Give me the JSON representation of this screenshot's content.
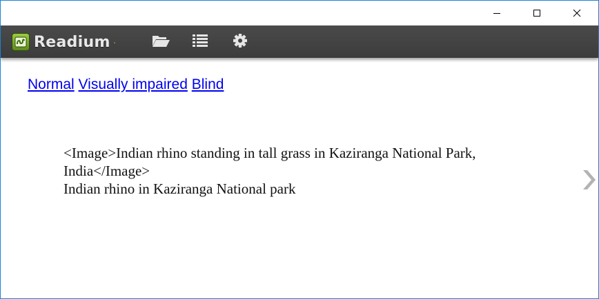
{
  "window": {
    "controls": {
      "minimize_icon": "minimize-icon",
      "maximize_icon": "maximize-icon",
      "close_icon": "close-icon"
    }
  },
  "toolbar": {
    "app_name": "Readium",
    "app_name_dot": "·",
    "accent_color": "#8cc63f",
    "background_color": "#444444",
    "buttons": [
      {
        "id": "library",
        "icon": "folder-open-icon"
      },
      {
        "id": "toc",
        "icon": "list-icon"
      },
      {
        "id": "settings",
        "icon": "gear-icon"
      }
    ]
  },
  "modes": {
    "normal": "Normal",
    "visually_impaired": "Visually impaired",
    "blind": "Blind",
    "link_color": "#0000ee"
  },
  "content": {
    "image_text": "<Image>Indian rhino standing in tall grass in Kaziranga National Park, India</Image>",
    "caption": "Indian rhino in Kaziranga National park"
  },
  "navigation": {
    "next_icon": "chevron-right-icon"
  }
}
